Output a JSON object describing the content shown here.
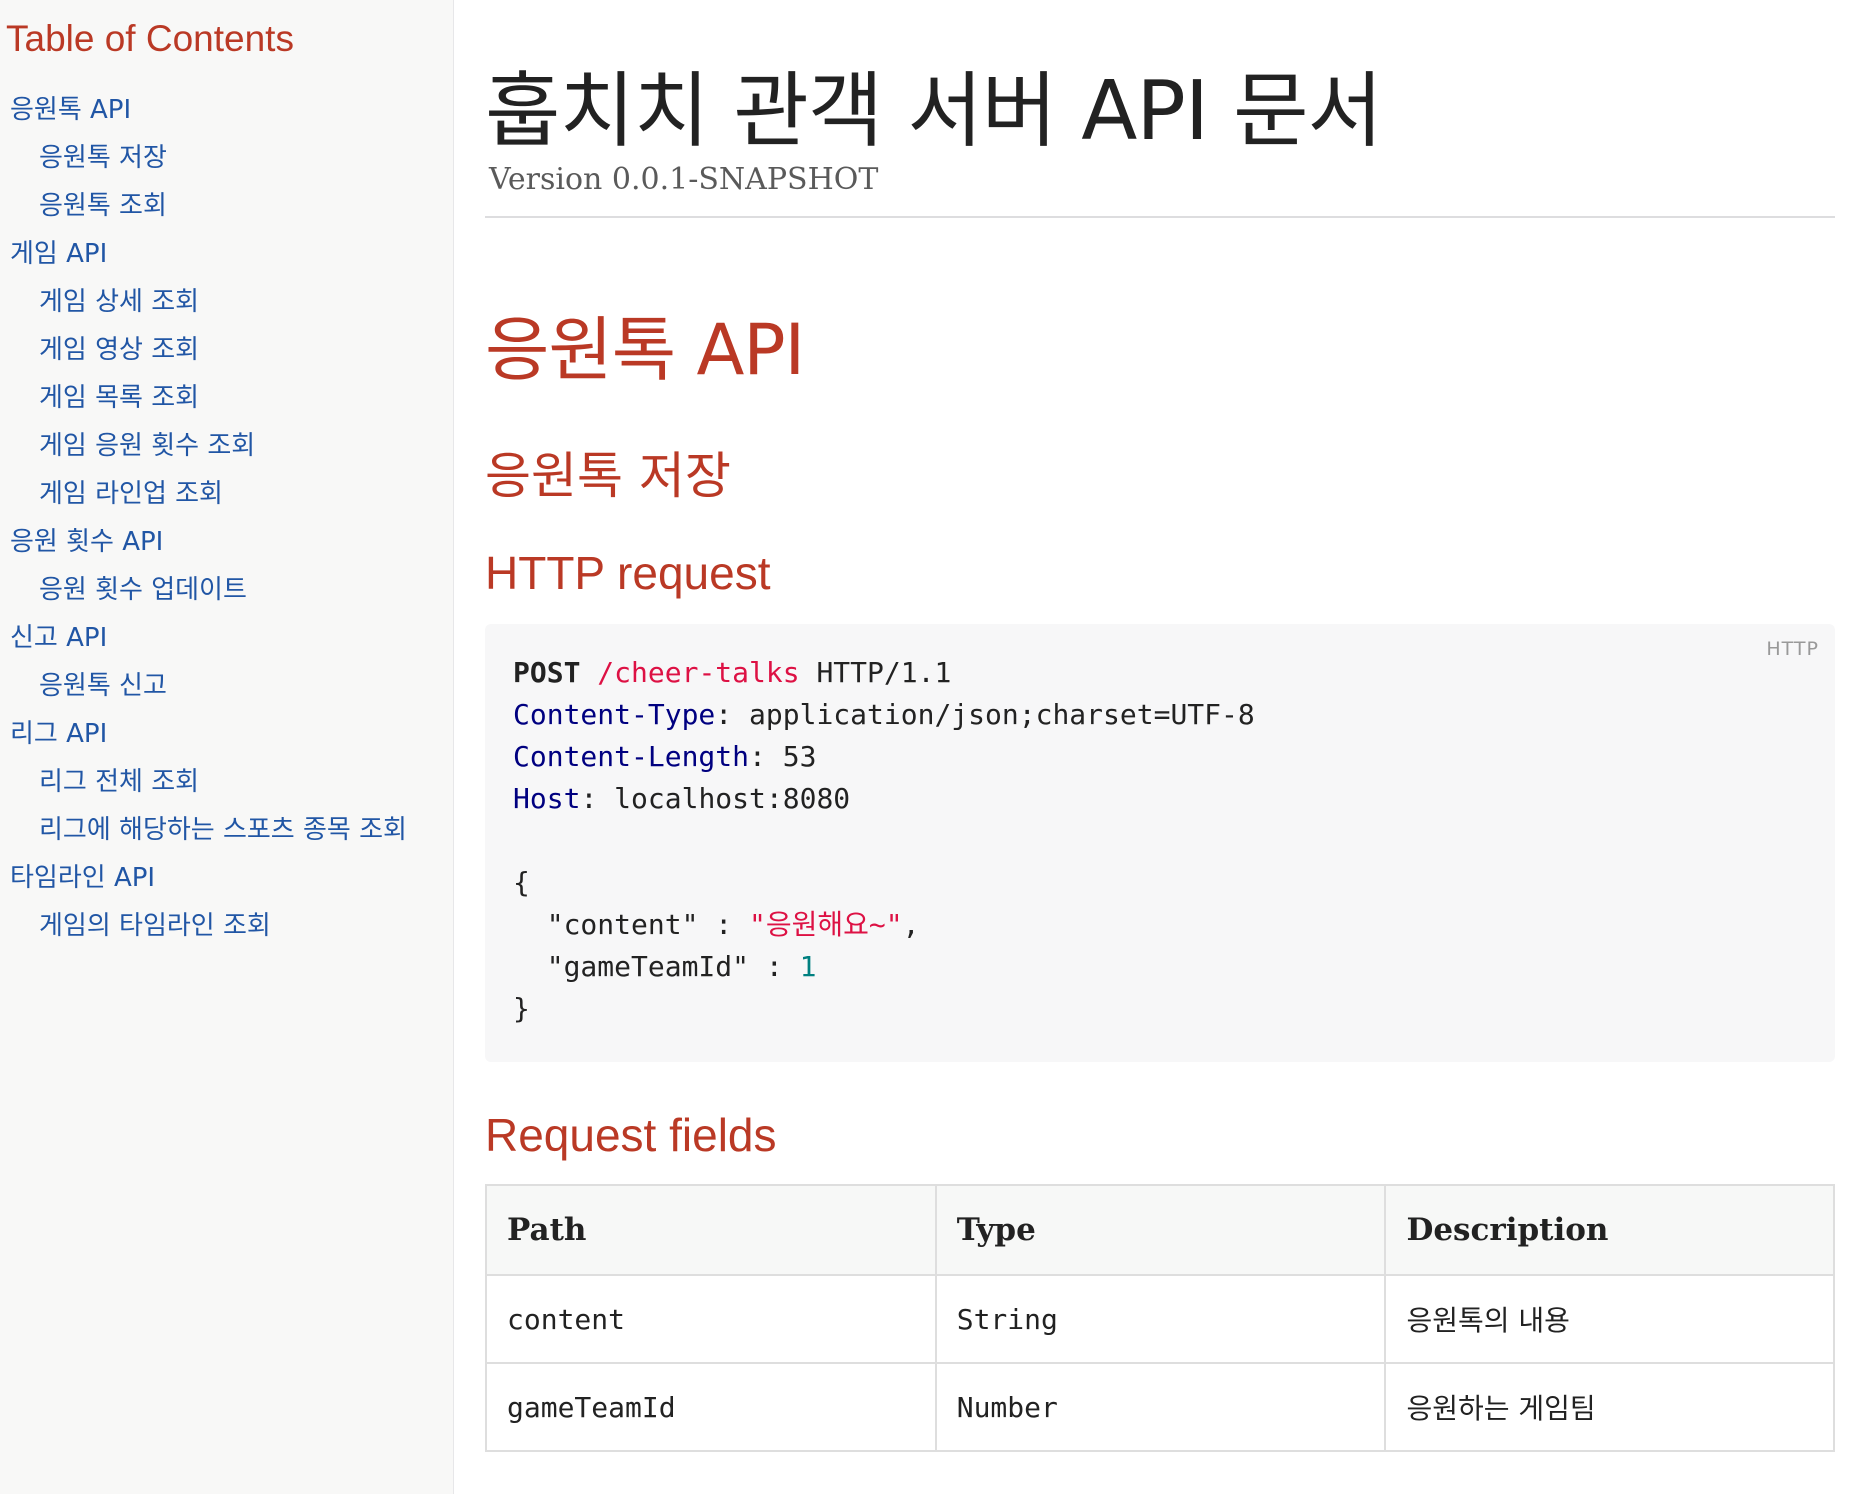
{
  "toc": {
    "title": "Table of Contents",
    "items": [
      {
        "label": "응원톡 API",
        "level": 1
      },
      {
        "label": "응원톡 저장",
        "level": 2
      },
      {
        "label": "응원톡 조회",
        "level": 2
      },
      {
        "label": "게임 API",
        "level": 1
      },
      {
        "label": "게임 상세 조회",
        "level": 2
      },
      {
        "label": "게임 영상 조회",
        "level": 2
      },
      {
        "label": "게임 목록 조회",
        "level": 2
      },
      {
        "label": "게임 응원 횟수 조회",
        "level": 2
      },
      {
        "label": "게임 라인업 조회",
        "level": 2
      },
      {
        "label": "응원 횟수 API",
        "level": 1
      },
      {
        "label": "응원 횟수 업데이트",
        "level": 2
      },
      {
        "label": "신고 API",
        "level": 1
      },
      {
        "label": "응원톡 신고",
        "level": 2
      },
      {
        "label": "리그 API",
        "level": 1
      },
      {
        "label": "리그 전체 조회",
        "level": 2
      },
      {
        "label": "리그에 해당하는 스포츠 종목 조회",
        "level": 2
      },
      {
        "label": "타임라인 API",
        "level": 1
      },
      {
        "label": "게임의 타임라인 조회",
        "level": 2
      }
    ]
  },
  "header": {
    "title": "훕치치 관객 서버 API 문서",
    "version": "Version 0.0.1-SNAPSHOT"
  },
  "section": {
    "title": "응원톡 API",
    "subsection": {
      "title": "응원톡 저장",
      "http_request_heading": "HTTP request",
      "code": {
        "language": "HTTP",
        "method": "POST",
        "path": "/cheer-talks",
        "protocol": "HTTP/1.1",
        "headers": [
          {
            "name": "Content-Type",
            "value": "application/json;charset=UTF-8"
          },
          {
            "name": "Content-Length",
            "value": "53"
          },
          {
            "name": "Host",
            "value": "localhost:8080"
          }
        ],
        "body_open": "{",
        "body_fields": [
          {
            "key": "\"content\"",
            "value": "\"응원해요~\"",
            "type": "string",
            "trailing": ","
          },
          {
            "key": "\"gameTeamId\"",
            "value": "1",
            "type": "number",
            "trailing": ""
          }
        ],
        "body_close": "}"
      },
      "request_fields_heading": "Request fields",
      "table": {
        "columns": [
          "Path",
          "Type",
          "Description"
        ],
        "rows": [
          [
            "content",
            "String",
            "응원톡의 내용"
          ],
          [
            "gameTeamId",
            "Number",
            "응원하는 게임팀"
          ]
        ]
      }
    }
  },
  "colors": {
    "heading_accent": "#ba3925",
    "link": "#2156a5",
    "sidebar_bg": "#f8f8f7",
    "code_bg": "#f7f7f8",
    "string": "#dd1144",
    "header_key": "#000080",
    "number": "#008080"
  }
}
